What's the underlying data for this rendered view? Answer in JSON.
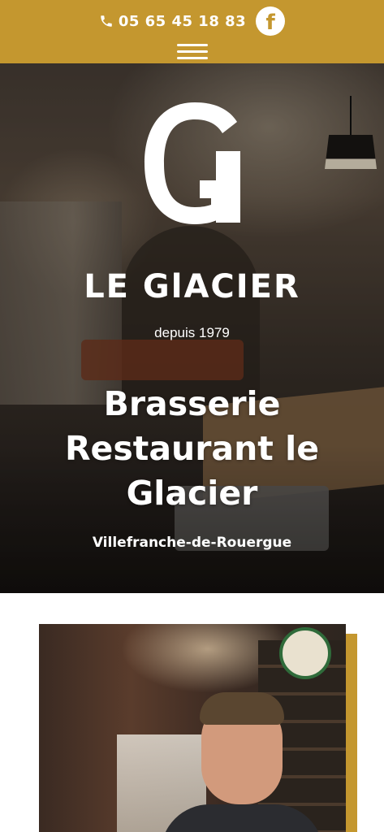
{
  "header": {
    "phone": "05 65 45 18 83",
    "phone_icon": "phone-icon",
    "social_icon": "facebook-icon",
    "menu_icon": "hamburger-menu-icon",
    "brand_color": "#c4972f"
  },
  "hero": {
    "logo_letter": "G",
    "wordmark": "LE GlACIER",
    "since": "depuis 1979",
    "title_line1": "Brasserie",
    "title_line2": "Restaurant le",
    "title_line3": "Glacier",
    "city": "Villefranche-de-Rouergue"
  }
}
